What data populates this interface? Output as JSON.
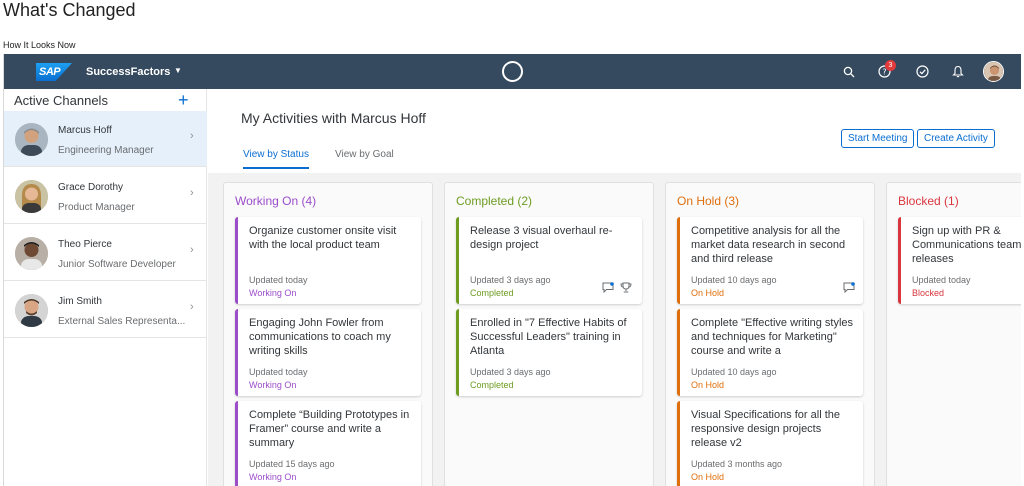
{
  "page": {
    "heading": "What's Changed",
    "subheading": "How It Looks Now"
  },
  "shell": {
    "logo": "SAP",
    "product": "SuccessFactors",
    "notification_badge": "3",
    "icons": [
      "search-icon",
      "help-icon",
      "todo-icon",
      "bell-icon"
    ]
  },
  "sidebar": {
    "title": "Active Channels",
    "channels": [
      {
        "name": "Marcus Hoff",
        "role": "Engineering Manager",
        "active": true
      },
      {
        "name": "Grace Dorothy",
        "role": "Product Manager",
        "active": false
      },
      {
        "name": "Theo Pierce",
        "role": "Junior Software Developer",
        "active": false
      },
      {
        "name": "Jim Smith",
        "role": "External Sales Representa...",
        "active": false
      }
    ]
  },
  "main": {
    "title": "My Activities with Marcus Hoff",
    "tabs": [
      {
        "label": "View by Status",
        "active": true
      },
      {
        "label": "View by Goal",
        "active": false
      }
    ],
    "buttons": {
      "start_meeting": "Start Meeting",
      "create_activity": "Create Activity"
    }
  },
  "columns": [
    {
      "title": "Working On (4)",
      "color": "#9b4dca",
      "cards": [
        {
          "title": "Organize customer onsite visit with the local product team",
          "updated": "Updated today",
          "status": "Working On"
        },
        {
          "title": "Engaging John Fowler from communications to coach my writing skills",
          "updated": "Updated today",
          "status": "Working On"
        },
        {
          "title": "Complete “Building Prototypes in Framer” course and write a summary",
          "updated": "Updated 15 days ago",
          "status": "Working On"
        }
      ]
    },
    {
      "title": "Completed (2)",
      "color": "#6e9c23",
      "cards": [
        {
          "title": "Release 3 visual overhaul re-design project",
          "updated": "Updated 3 days ago",
          "status": "Completed",
          "icons": [
            "comment-icon",
            "trophy-icon"
          ]
        },
        {
          "title": "Enrolled in \"7 Effective Habits of Successful Leaders\" training in Atlanta",
          "updated": "Updated 3 days ago",
          "status": "Completed"
        }
      ]
    },
    {
      "title": "On Hold (3)",
      "color": "#df6e0c",
      "cards": [
        {
          "title": "Competitive analysis for all the market data research in second and third release",
          "updated": "Updated 10 days ago",
          "status": "On Hold",
          "icons": [
            "comment-icon"
          ]
        },
        {
          "title": "Complete \"Effective writing styles and techniques for Marketing\" course and write a",
          "updated": "Updated 10 days ago",
          "status": "On Hold"
        },
        {
          "title": "Visual Specifications for all the responsive design projects release v2",
          "updated": "Updated 3 months ago",
          "status": "On Hold"
        }
      ]
    },
    {
      "title": "Blocked (1)",
      "color": "#d9363e",
      "cards": [
        {
          "title": "Sign up with PR & Communications team press releases",
          "updated": "Updated today",
          "status": "Blocked"
        }
      ]
    }
  ]
}
